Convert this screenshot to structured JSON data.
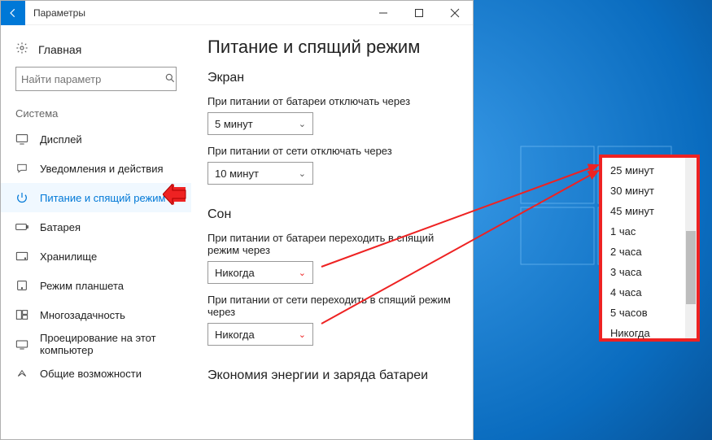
{
  "window": {
    "title": "Параметры"
  },
  "sidebar": {
    "home": "Главная",
    "search_placeholder": "Найти параметр",
    "category": "Система",
    "items": [
      {
        "label": "Дисплей"
      },
      {
        "label": "Уведомления и действия"
      },
      {
        "label": "Питание и спящий режим"
      },
      {
        "label": "Батарея"
      },
      {
        "label": "Хранилище"
      },
      {
        "label": "Режим планшета"
      },
      {
        "label": "Многозадачность"
      },
      {
        "label": "Проецирование на этот компьютер"
      },
      {
        "label": "Общие возможности"
      }
    ]
  },
  "main": {
    "title": "Питание и спящий режим",
    "section_screen": "Экран",
    "screen_battery_label": "При питании от батареи отключать через",
    "screen_battery_value": "5 минут",
    "screen_ac_label": "При питании от сети отключать через",
    "screen_ac_value": "10 минут",
    "section_sleep": "Сон",
    "sleep_battery_label": "При питании от батареи переходить в спящий режим через",
    "sleep_battery_value": "Никогда",
    "sleep_ac_label": "При питании от сети переходить в спящий режим через",
    "sleep_ac_value": "Никогда",
    "section_energy": "Экономия энергии и заряда батареи"
  },
  "dropdown": {
    "items": [
      "25 минут",
      "30 минут",
      "45 минут",
      "1 час",
      "2 часа",
      "3 часа",
      "4 часа",
      "5 часов",
      "Никогда"
    ]
  }
}
